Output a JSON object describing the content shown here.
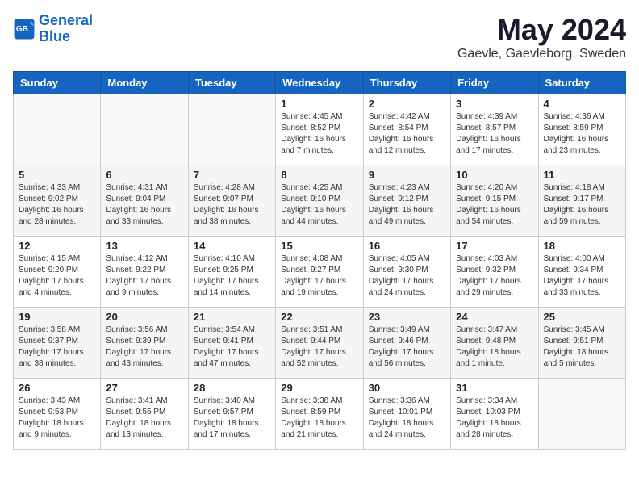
{
  "header": {
    "logo_line1": "General",
    "logo_line2": "Blue",
    "month": "May 2024",
    "location": "Gaevle, Gaevleborg, Sweden"
  },
  "days_of_week": [
    "Sunday",
    "Monday",
    "Tuesday",
    "Wednesday",
    "Thursday",
    "Friday",
    "Saturday"
  ],
  "weeks": [
    [
      {
        "num": "",
        "detail": ""
      },
      {
        "num": "",
        "detail": ""
      },
      {
        "num": "",
        "detail": ""
      },
      {
        "num": "1",
        "detail": "Sunrise: 4:45 AM\nSunset: 8:52 PM\nDaylight: 16 hours\nand 7 minutes."
      },
      {
        "num": "2",
        "detail": "Sunrise: 4:42 AM\nSunset: 8:54 PM\nDaylight: 16 hours\nand 12 minutes."
      },
      {
        "num": "3",
        "detail": "Sunrise: 4:39 AM\nSunset: 8:57 PM\nDaylight: 16 hours\nand 17 minutes."
      },
      {
        "num": "4",
        "detail": "Sunrise: 4:36 AM\nSunset: 8:59 PM\nDaylight: 16 hours\nand 23 minutes."
      }
    ],
    [
      {
        "num": "5",
        "detail": "Sunrise: 4:33 AM\nSunset: 9:02 PM\nDaylight: 16 hours\nand 28 minutes."
      },
      {
        "num": "6",
        "detail": "Sunrise: 4:31 AM\nSunset: 9:04 PM\nDaylight: 16 hours\nand 33 minutes."
      },
      {
        "num": "7",
        "detail": "Sunrise: 4:28 AM\nSunset: 9:07 PM\nDaylight: 16 hours\nand 38 minutes."
      },
      {
        "num": "8",
        "detail": "Sunrise: 4:25 AM\nSunset: 9:10 PM\nDaylight: 16 hours\nand 44 minutes."
      },
      {
        "num": "9",
        "detail": "Sunrise: 4:23 AM\nSunset: 9:12 PM\nDaylight: 16 hours\nand 49 minutes."
      },
      {
        "num": "10",
        "detail": "Sunrise: 4:20 AM\nSunset: 9:15 PM\nDaylight: 16 hours\nand 54 minutes."
      },
      {
        "num": "11",
        "detail": "Sunrise: 4:18 AM\nSunset: 9:17 PM\nDaylight: 16 hours\nand 59 minutes."
      }
    ],
    [
      {
        "num": "12",
        "detail": "Sunrise: 4:15 AM\nSunset: 9:20 PM\nDaylight: 17 hours\nand 4 minutes."
      },
      {
        "num": "13",
        "detail": "Sunrise: 4:12 AM\nSunset: 9:22 PM\nDaylight: 17 hours\nand 9 minutes."
      },
      {
        "num": "14",
        "detail": "Sunrise: 4:10 AM\nSunset: 9:25 PM\nDaylight: 17 hours\nand 14 minutes."
      },
      {
        "num": "15",
        "detail": "Sunrise: 4:08 AM\nSunset: 9:27 PM\nDaylight: 17 hours\nand 19 minutes."
      },
      {
        "num": "16",
        "detail": "Sunrise: 4:05 AM\nSunset: 9:30 PM\nDaylight: 17 hours\nand 24 minutes."
      },
      {
        "num": "17",
        "detail": "Sunrise: 4:03 AM\nSunset: 9:32 PM\nDaylight: 17 hours\nand 29 minutes."
      },
      {
        "num": "18",
        "detail": "Sunrise: 4:00 AM\nSunset: 9:34 PM\nDaylight: 17 hours\nand 33 minutes."
      }
    ],
    [
      {
        "num": "19",
        "detail": "Sunrise: 3:58 AM\nSunset: 9:37 PM\nDaylight: 17 hours\nand 38 minutes."
      },
      {
        "num": "20",
        "detail": "Sunrise: 3:56 AM\nSunset: 9:39 PM\nDaylight: 17 hours\nand 43 minutes."
      },
      {
        "num": "21",
        "detail": "Sunrise: 3:54 AM\nSunset: 9:41 PM\nDaylight: 17 hours\nand 47 minutes."
      },
      {
        "num": "22",
        "detail": "Sunrise: 3:51 AM\nSunset: 9:44 PM\nDaylight: 17 hours\nand 52 minutes."
      },
      {
        "num": "23",
        "detail": "Sunrise: 3:49 AM\nSunset: 9:46 PM\nDaylight: 17 hours\nand 56 minutes."
      },
      {
        "num": "24",
        "detail": "Sunrise: 3:47 AM\nSunset: 9:48 PM\nDaylight: 18 hours\nand 1 minute."
      },
      {
        "num": "25",
        "detail": "Sunrise: 3:45 AM\nSunset: 9:51 PM\nDaylight: 18 hours\nand 5 minutes."
      }
    ],
    [
      {
        "num": "26",
        "detail": "Sunrise: 3:43 AM\nSunset: 9:53 PM\nDaylight: 18 hours\nand 9 minutes."
      },
      {
        "num": "27",
        "detail": "Sunrise: 3:41 AM\nSunset: 9:55 PM\nDaylight: 18 hours\nand 13 minutes."
      },
      {
        "num": "28",
        "detail": "Sunrise: 3:40 AM\nSunset: 9:57 PM\nDaylight: 18 hours\nand 17 minutes."
      },
      {
        "num": "29",
        "detail": "Sunrise: 3:38 AM\nSunset: 8:59 PM\nDaylight: 18 hours\nand 21 minutes."
      },
      {
        "num": "30",
        "detail": "Sunrise: 3:36 AM\nSunset: 10:01 PM\nDaylight: 18 hours\nand 24 minutes."
      },
      {
        "num": "31",
        "detail": "Sunrise: 3:34 AM\nSunset: 10:03 PM\nDaylight: 18 hours\nand 28 minutes."
      },
      {
        "num": "",
        "detail": ""
      }
    ]
  ]
}
